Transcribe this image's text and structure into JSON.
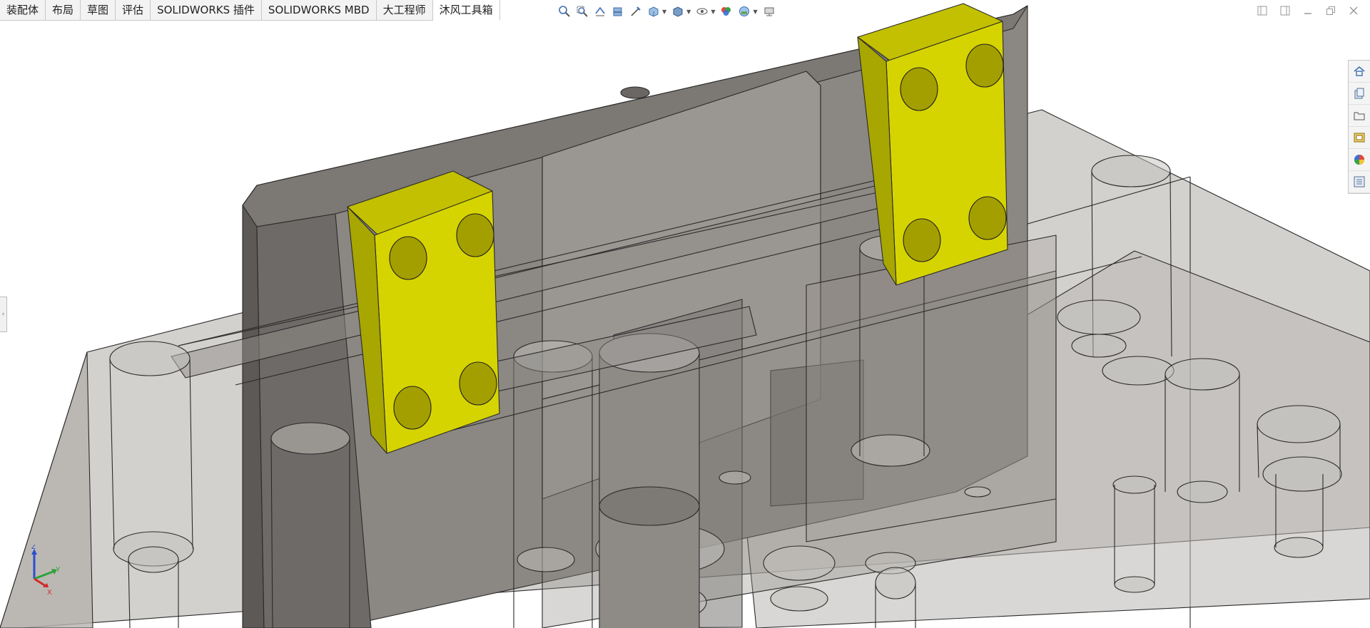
{
  "tabs": [
    {
      "label": "装配体"
    },
    {
      "label": "布局"
    },
    {
      "label": "草图"
    },
    {
      "label": "评估"
    },
    {
      "label": "SOLIDWORKS 插件"
    },
    {
      "label": "SOLIDWORKS MBD"
    },
    {
      "label": "大工程师"
    },
    {
      "label": "沐风工具箱"
    }
  ],
  "active_tab": "沐风工具箱",
  "view_toolbar": [
    "zoom-to-fit-icon",
    "zoom-to-area-icon",
    "previous-view-icon",
    "section-view-icon",
    "dynamic-annotation-icon",
    "view-orientation-icon",
    "display-style-icon",
    "hide-show-items-icon",
    "edit-appearance-icon",
    "apply-scene-icon",
    "view-settings-icon"
  ],
  "task_pane": [
    "solidworks-resources-icon",
    "design-library-icon",
    "file-explorer-icon",
    "view-palette-icon",
    "appearances-scenes-icon",
    "custom-properties-icon"
  ],
  "triad": {
    "x": "X",
    "y": "Y",
    "z": "Z"
  },
  "colors": {
    "accent_yellow": "#d6d400",
    "part_gray": "#8c8884",
    "transparent_gray": "#a09d9a",
    "edge": "#1e1e1e",
    "background": "#ffffff"
  }
}
